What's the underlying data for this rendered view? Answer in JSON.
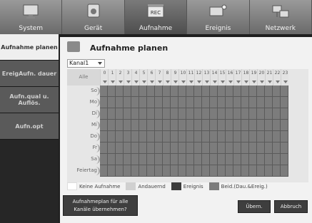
{
  "top_tabs": [
    {
      "label": "System",
      "icon": "monitor-icon"
    },
    {
      "label": "Gerät",
      "icon": "camera-icon"
    },
    {
      "label": "Aufnahme",
      "icon": "rec-icon"
    },
    {
      "label": "Ereignis",
      "icon": "event-icon"
    },
    {
      "label": "Netzwerk",
      "icon": "network-icon"
    }
  ],
  "active_tab": "Aufnahme",
  "sidebar": [
    {
      "label": "Aufnahme planen"
    },
    {
      "label": "EreigAufn. dauer"
    },
    {
      "label": "Aufn.qual u. Auflös."
    },
    {
      "label": "Aufn.opt"
    }
  ],
  "panel": {
    "title": "Aufnahme planen",
    "channel": "Kanal1",
    "all_label": "Alle",
    "hours": [
      "0",
      "1",
      "2",
      "3",
      "4",
      "5",
      "6",
      "7",
      "8",
      "9",
      "10",
      "11",
      "12",
      "13",
      "14",
      "15",
      "16",
      "17",
      "18",
      "19",
      "20",
      "21",
      "22",
      "23"
    ],
    "days": [
      "So",
      "Mo",
      "Di",
      "Mi",
      "Do",
      "Fr",
      "Sa",
      "Feiertag"
    ]
  },
  "legend": [
    {
      "label": "Keine Aufnahme",
      "color": "#ffffff"
    },
    {
      "label": "Andauernd",
      "color": "#d0d0d0"
    },
    {
      "label": "Ereignis",
      "color": "#3c3c3c"
    },
    {
      "label": "Beid.(Dau.&Ereig.)",
      "color": "#7c7c7c"
    }
  ],
  "buttons": {
    "copy_line1": "Aufnahmeplan für alle",
    "copy_line2": "Kanäle übernehmen?",
    "ok": "Übern.",
    "cancel": "Abbruch"
  },
  "colors": {
    "cell_both": "#7c7c7c",
    "active_sidebar": "#efefef"
  }
}
